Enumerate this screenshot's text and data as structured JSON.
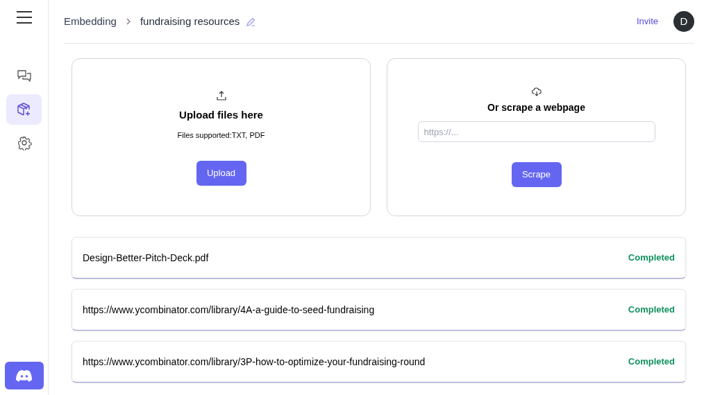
{
  "sidebar": {
    "items": [
      {
        "kind": "chat",
        "selected": false
      },
      {
        "kind": "embedding",
        "selected": true
      },
      {
        "kind": "settings",
        "selected": false
      }
    ]
  },
  "breadcrumb": {
    "parent": "Embedding",
    "current": "fundraising resources"
  },
  "header": {
    "invite": "Invite",
    "avatar": "D"
  },
  "upload": {
    "title": "Upload files here",
    "subtitle": "Files supported:TXT, PDF",
    "button": "Upload"
  },
  "scrape": {
    "title": "Or scrape a webpage",
    "placeholder": "https://...",
    "button": "Scrape"
  },
  "documents": [
    {
      "name": "Design-Better-Pitch-Deck.pdf",
      "status": "Completed",
      "color": "#10915f"
    },
    {
      "name": "https://www.ycombinator.com/library/4A-a-guide-to-seed-fundraising",
      "status": "Completed",
      "color": "#10915f"
    },
    {
      "name": "https://www.ycombinator.com/library/3P-how-to-optimize-your-fundraising-round",
      "status": "Completed",
      "color": "#10915f"
    }
  ]
}
